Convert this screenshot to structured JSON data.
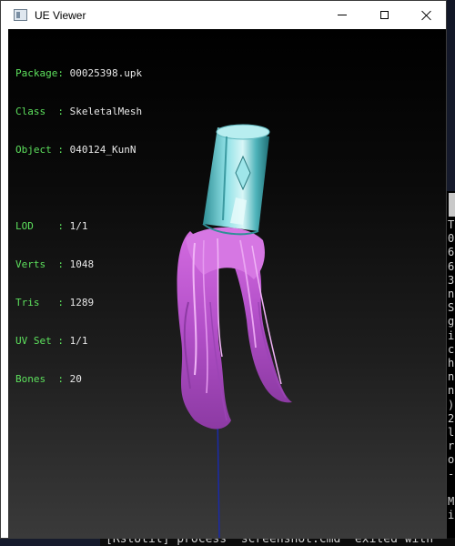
{
  "window": {
    "title": "UE Viewer",
    "controls": {
      "minimize": "minimize",
      "maximize": "maximize",
      "close": "close"
    }
  },
  "info": {
    "package": {
      "key": "Package:",
      "value": "00025398.upk"
    },
    "class": {
      "key": "Class  :",
      "value": "SkeletalMesh"
    },
    "object": {
      "key": "Object :",
      "value": "040124_KunN"
    },
    "lod": {
      "key": "LOD    :",
      "value": "1/1"
    },
    "verts": {
      "key": "Verts  :",
      "value": "1048"
    },
    "tris": {
      "key": "Tris   :",
      "value": "1289"
    },
    "uvset": {
      "key": "UV Set :",
      "value": "1/1"
    },
    "bones": {
      "key": "Bones  :",
      "value": "20"
    }
  },
  "background_console": {
    "right_column": "T\n0\n6\n6\n3\nn\nS\ng\ni\nc\nh\nn\nn\n)\n2\nl\nr\no\n-\n\nM\ni",
    "bottom_line": "[RstUtil] process \"screenshot.cmd\" exited with",
    "left_char": "M"
  },
  "colors": {
    "label_green": "#5de05d",
    "value_white": "#e8e8e8",
    "hair_magenta": "#c85ad8",
    "cylinder_cyan": "#6ec9cf",
    "bone_blue": "#1a2aa8"
  }
}
